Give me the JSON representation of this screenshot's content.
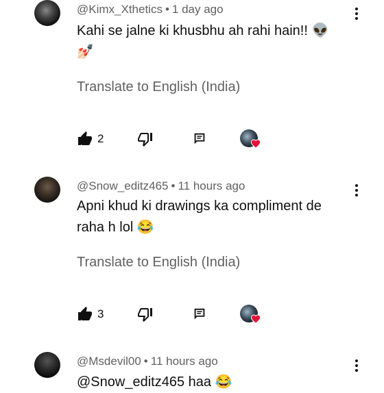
{
  "comments": [
    {
      "author": "@Kimx_Xthetics",
      "time": "1 day ago",
      "text": "Kahi se jalne ki khusbhu ah rahi hain!! 👽",
      "text_line2": "💅🏻",
      "translate": "Translate to English (India)",
      "likes": "2"
    },
    {
      "author": "@Snow_editz465",
      "time": "11 hours ago",
      "text": "Apni khud ki drawings ka compliment de",
      "text_line2": "raha h lol 😂",
      "translate": "Translate to English (India)",
      "likes": "3"
    },
    {
      "author": "@Msdevil00",
      "time": "11 hours ago",
      "text": "@Snow_editz465 haa 😂"
    }
  ],
  "separator": "•",
  "icons": {
    "like": "thumbs-up-filled-icon",
    "dislike": "thumbs-down-outline-icon",
    "reply": "reply-icon",
    "more": "vertical-dots-icon",
    "creator_heart": "creator-heart-icon"
  },
  "colors": {
    "meta": "#606060",
    "text": "#0f0f0f",
    "heart": "#e5133a"
  }
}
